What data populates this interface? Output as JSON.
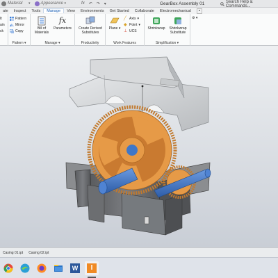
{
  "title_bar": {
    "material_value": "Material",
    "appearance_value": "Appearance",
    "document_title": "GearBox Assembly 01",
    "search_placeholder": "Search Help & Commands...",
    "material_dot_color": "#7a7a7a",
    "appearance_dot_color": "#8a6fc8"
  },
  "menu": {
    "items": [
      "ate",
      "Inspect",
      "Tools",
      "Manage",
      "View",
      "Environments",
      "Get Started",
      "Collaborate",
      "Electromechanical"
    ],
    "active_index": 2
  },
  "ribbon": {
    "pattern_panel": {
      "label": "Pattern",
      "items": [
        "Pattern",
        "Mirror",
        "Copy"
      ],
      "partial_items": [
        "It",
        "ain",
        "ck"
      ]
    },
    "manage_panel": {
      "label": "Manage",
      "bill_of_materials": "Bill of Materials",
      "parameters": "Parameters"
    },
    "productivity_panel": {
      "label": "Productivity",
      "create_derived": "Create Derived Substitutes"
    },
    "work_features_panel": {
      "label": "Work Features",
      "plane": "Plane",
      "axis": "Axis",
      "point": "Point",
      "ucs": "UCS"
    },
    "simplification_panel": {
      "label": "Simplification",
      "shrinkwrap": "Shrinkwrap",
      "shrinkwrap_substitute": "Shrinkwrap Substitute"
    }
  },
  "viewport": {
    "background_top": "#eef0f2",
    "background_bottom": "#c9ced6",
    "gear_color": "#e69a47",
    "shaft_color": "#3f77c8",
    "housing_color": "#6e7073",
    "cover_color": "#d3d5d7"
  },
  "document_tabs": [
    "Casing 01.ipt",
    "Casing 02.ipt"
  ],
  "taskbar": {
    "apps": [
      "chrome-icon",
      "edge-icon",
      "firefox-icon",
      "explorer-icon",
      "word-icon",
      "inventor-icon"
    ],
    "active_app_letter": "I",
    "word_letter": "W"
  }
}
